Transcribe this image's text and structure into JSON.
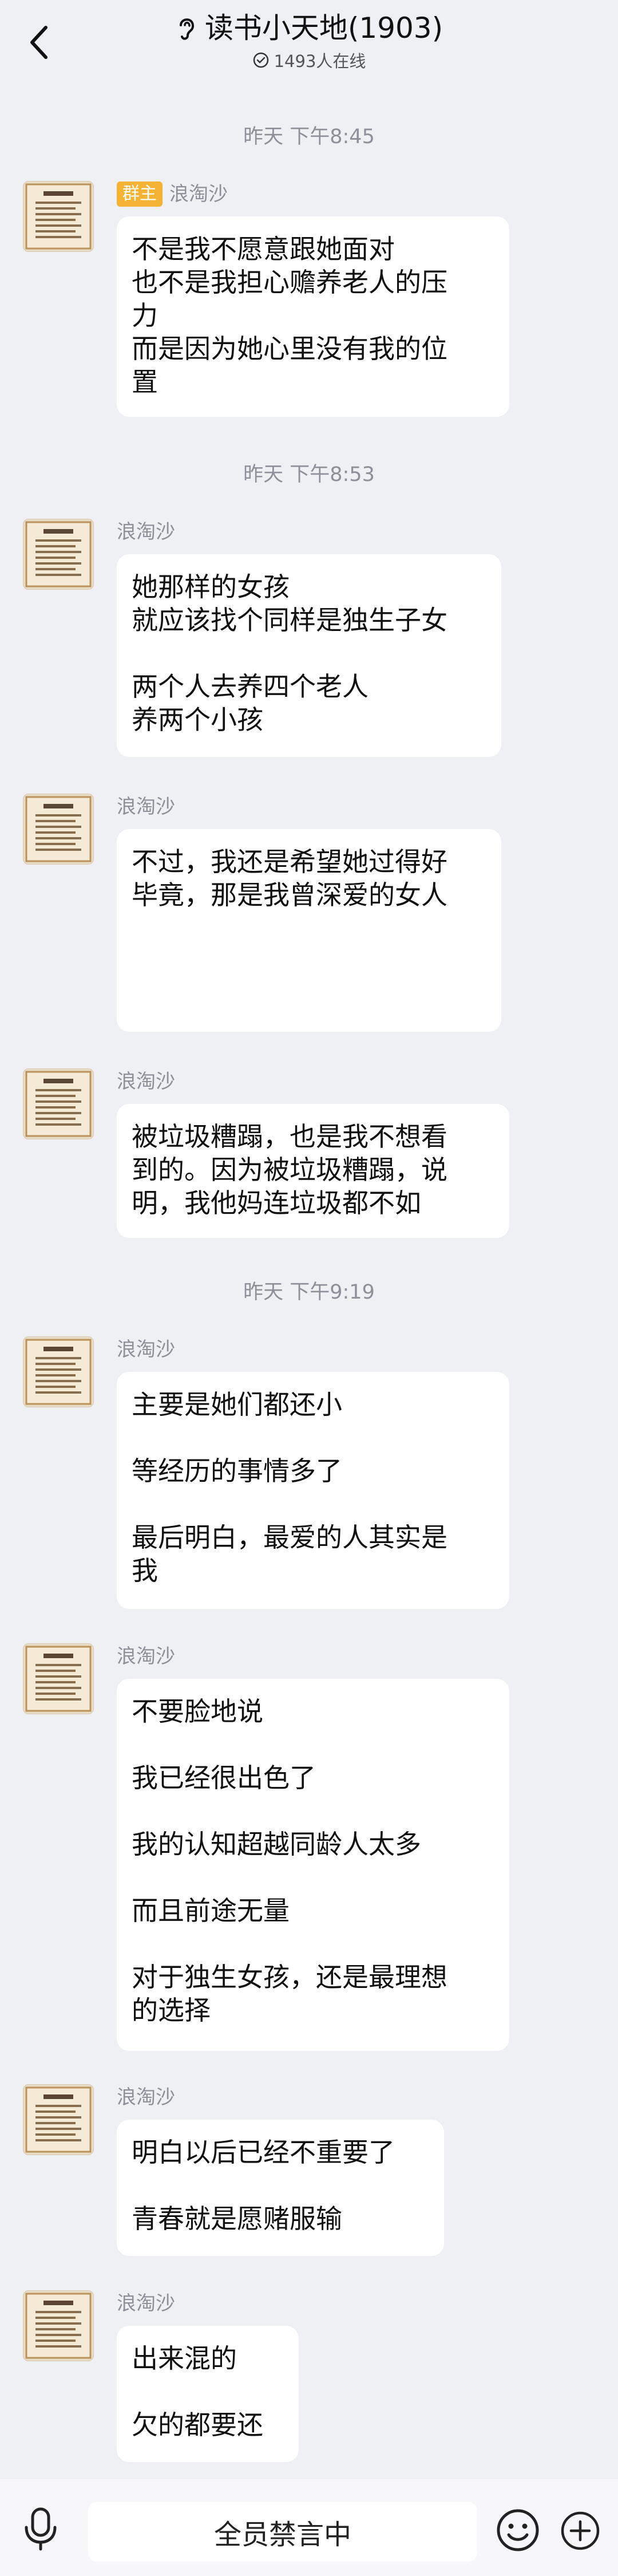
{
  "header": {
    "group_name": "读书小天地(1903)",
    "online_count": "1493人在线",
    "back_icon": "chevron-left-icon",
    "ear_icon": "ear-icon",
    "online_icon": "check-circle-icon"
  },
  "timestamps": [
    "昨天 下午8:45",
    "昨天 下午8:53",
    "昨天 下午9:19"
  ],
  "messages": [
    {
      "sender": "浪淘沙",
      "badge": "群主",
      "lines": [
        "不是我不愿意跟她面对",
        "也不是我担心赡养老人的压",
        "力",
        "而是因为她心里没有我的位",
        "置"
      ]
    },
    {
      "sender": "浪淘沙",
      "lines": [
        "她那样的女孩",
        "就应该找个同样是独生子女",
        "",
        "两个人去养四个老人",
        "养两个小孩"
      ]
    },
    {
      "sender": "浪淘沙",
      "lines": [
        "不过，我还是希望她过得好",
        "毕竟，那是我曾深爱的女人"
      ]
    },
    {
      "sender": "浪淘沙",
      "lines": [
        "被垃圾糟蹋，也是我不想看",
        "到的。因为被垃圾糟蹋，说",
        "明，我他妈连垃圾都不如"
      ]
    },
    {
      "sender": "浪淘沙",
      "lines": [
        "主要是她们都还小",
        "",
        "等经历的事情多了",
        "",
        "最后明白，最爱的人其实是",
        "我"
      ]
    },
    {
      "sender": "浪淘沙",
      "lines": [
        "不要脸地说",
        "",
        "我已经很出色了",
        "",
        "我的认知超越同龄人太多",
        "",
        "而且前途无量",
        "",
        "对于独生女孩，还是最理想",
        "的选择"
      ]
    },
    {
      "sender": "浪淘沙",
      "lines": [
        "明白以后已经不重要了",
        "",
        "青春就是愿赌服输"
      ]
    },
    {
      "sender": "浪淘沙",
      "lines": [
        "出来混的",
        "",
        "欠的都要还"
      ]
    }
  ],
  "bottom_bar": {
    "muted_text": "全员禁言中",
    "mic_icon": "microphone-icon",
    "emoji_icon": "smile-icon",
    "plus_icon": "plus-circle-icon"
  }
}
